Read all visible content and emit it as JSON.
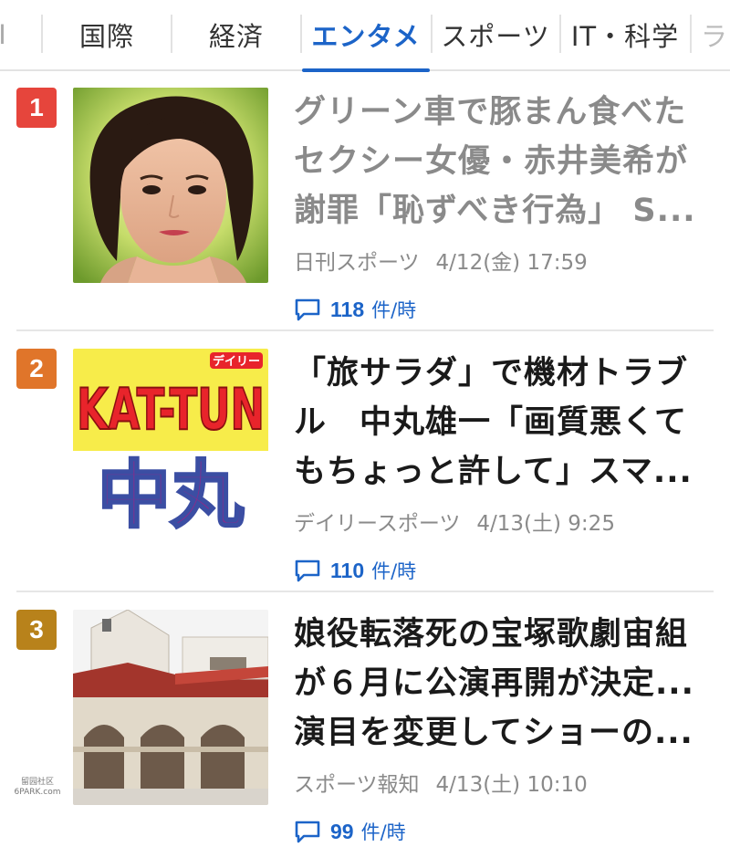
{
  "tabs": [
    {
      "label": "I",
      "active": false
    },
    {
      "label": "国際",
      "active": false
    },
    {
      "label": "経済",
      "active": false
    },
    {
      "label": "エンタメ",
      "active": true
    },
    {
      "label": "スポーツ",
      "active": false
    },
    {
      "label": "IT・科学",
      "active": false
    },
    {
      "label": "ラ",
      "active": false
    }
  ],
  "articles": [
    {
      "rank": "1",
      "rank_color": "#e6453c",
      "title": "グリーン車で豚まん食べたセクシー女優・赤井美希が謝罪「恥ずべき行為」 S...",
      "visited": true,
      "source": "日刊スポーツ",
      "date": "4/12(金) 17:59",
      "comment_count": "118",
      "comment_unit": "件/時",
      "thumb_icon": "portrait-photo"
    },
    {
      "rank": "2",
      "rank_color": "#e0752a",
      "title": "「旅サラダ」で機材トラブル　中丸雄一「画質悪くてもちょっと許して」スマ...",
      "visited": false,
      "source": "デイリースポーツ",
      "date": "4/13(土) 9:25",
      "comment_count": "110",
      "comment_unit": "件/時",
      "thumb_icon": "kat-tun-logo",
      "thumb_text": {
        "badge": "デイリー",
        "top": "KAT-TUN",
        "bottom": "中丸"
      }
    },
    {
      "rank": "3",
      "rank_color": "#b8821b",
      "title": "娘役転落死の宝塚歌劇宙組が６月に公演再開が決定...演目を変更してショーの...",
      "visited": false,
      "source": "スポーツ報知",
      "date": "4/13(土) 10:10",
      "comment_count": "99",
      "comment_unit": "件/時",
      "thumb_icon": "theater-building-photo"
    }
  ],
  "watermark": {
    "line1": "留园社区",
    "line2": "6PARK.com"
  }
}
